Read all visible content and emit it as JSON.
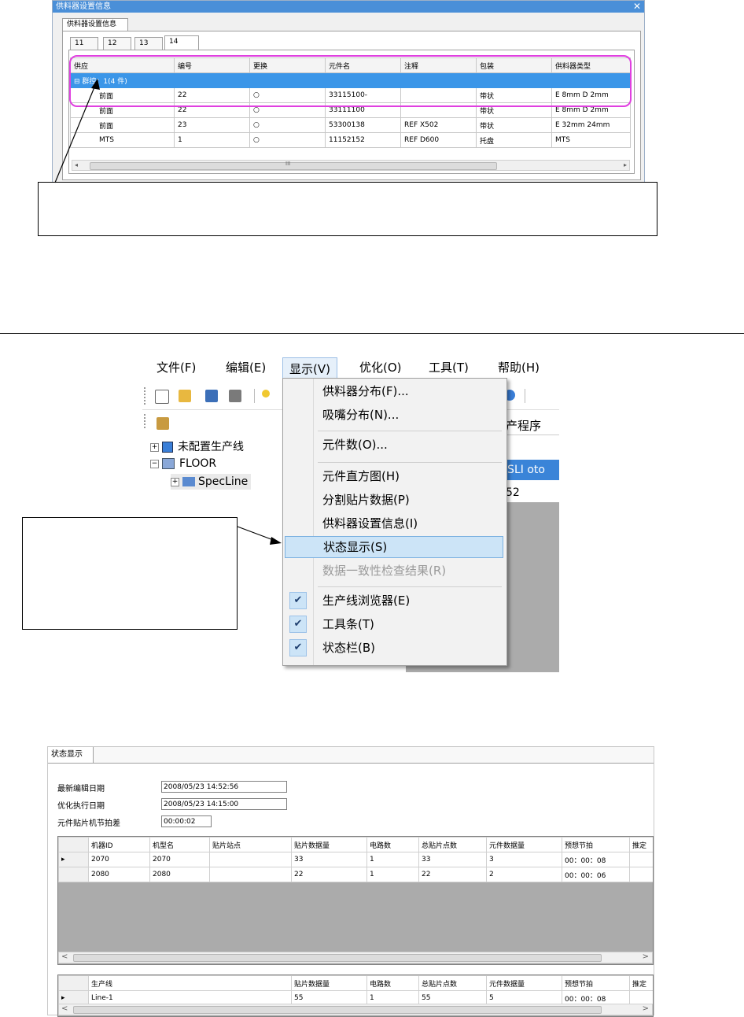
{
  "top_window": {
    "title": "供料器设置信息",
    "close": "✕",
    "outer_tab": "供料器设置信息",
    "tabs": [
      "11",
      "12",
      "13",
      "14"
    ],
    "headers": [
      "供应",
      "编号",
      "更换",
      "元件名",
      "注释",
      "包装",
      "供料器类型"
    ],
    "group_toggle": "⊟",
    "group_label": "群控：1(4 件)",
    "rows": [
      [
        "前面",
        "22",
        "○",
        "33115100-",
        "",
        "带状",
        "E 8mm D 2mm"
      ],
      [
        "前面",
        "22",
        "○",
        "33111100",
        "",
        "带状",
        "E 8mm D 2mm"
      ],
      [
        "前面",
        "23",
        "○",
        "53300138",
        "REF X502",
        "带状",
        "E 32mm 24mm"
      ],
      [
        "MTS",
        "1",
        "○",
        "11152152",
        "REF D600",
        "托盘",
        "MTS"
      ]
    ],
    "scroll_mid": "III"
  },
  "middle": {
    "menubar": [
      "文件(F)",
      "编辑(E)",
      "显示(V)",
      "优化(O)",
      "工具(T)",
      "帮助(H)"
    ],
    "tree": {
      "node1": "未配置生产线",
      "node2": "FLOOR",
      "node3": "SpecLine"
    },
    "right_header": "产程序",
    "right_sel": "-SLI oto",
    "right_row2": "52",
    "menu_items": [
      "供料器分布(F)...",
      "吸嘴分布(N)...",
      "元件数(O)...",
      "元件直方图(H)",
      "分割贴片数据(P)",
      "供料器设置信息(I)",
      "状态显示(S)",
      "数据一致性检查结果(R)",
      "生产线浏览器(E)",
      "工具条(T)",
      "状态栏(B)"
    ],
    "check": "✔"
  },
  "bottom": {
    "tab": "状态显示",
    "fields": [
      {
        "label": "最新编辑日期",
        "value": "2008/05/23 14:52:56"
      },
      {
        "label": "优化执行日期",
        "value": "2008/05/23 14:15:00"
      },
      {
        "label": "元件贴片机节拍差",
        "value": "00:00:02"
      }
    ],
    "t1_headers": [
      "机器ID",
      "机型名",
      "贴片站点",
      "贴片数据量",
      "电路数",
      "总贴片点数",
      "元件数据量",
      "预想节拍",
      "推定"
    ],
    "t1_rows": [
      [
        "2070",
        "2070",
        "",
        "33",
        "1",
        "33",
        "3",
        "00：00：08",
        ""
      ],
      [
        "2080",
        "2080",
        "",
        "22",
        "1",
        "22",
        "2",
        "00：00：06",
        ""
      ]
    ],
    "t2_headers": [
      "生产线",
      "贴片数据量",
      "电路数",
      "总贴片点数",
      "元件数据量",
      "预想节拍",
      "推定"
    ],
    "t2_rows": [
      [
        "Line-1",
        "55",
        "1",
        "55",
        "5",
        "00：00：08",
        ""
      ]
    ],
    "row_marker": "▸",
    "arrow_left": "<",
    "arrow_right": ">"
  }
}
